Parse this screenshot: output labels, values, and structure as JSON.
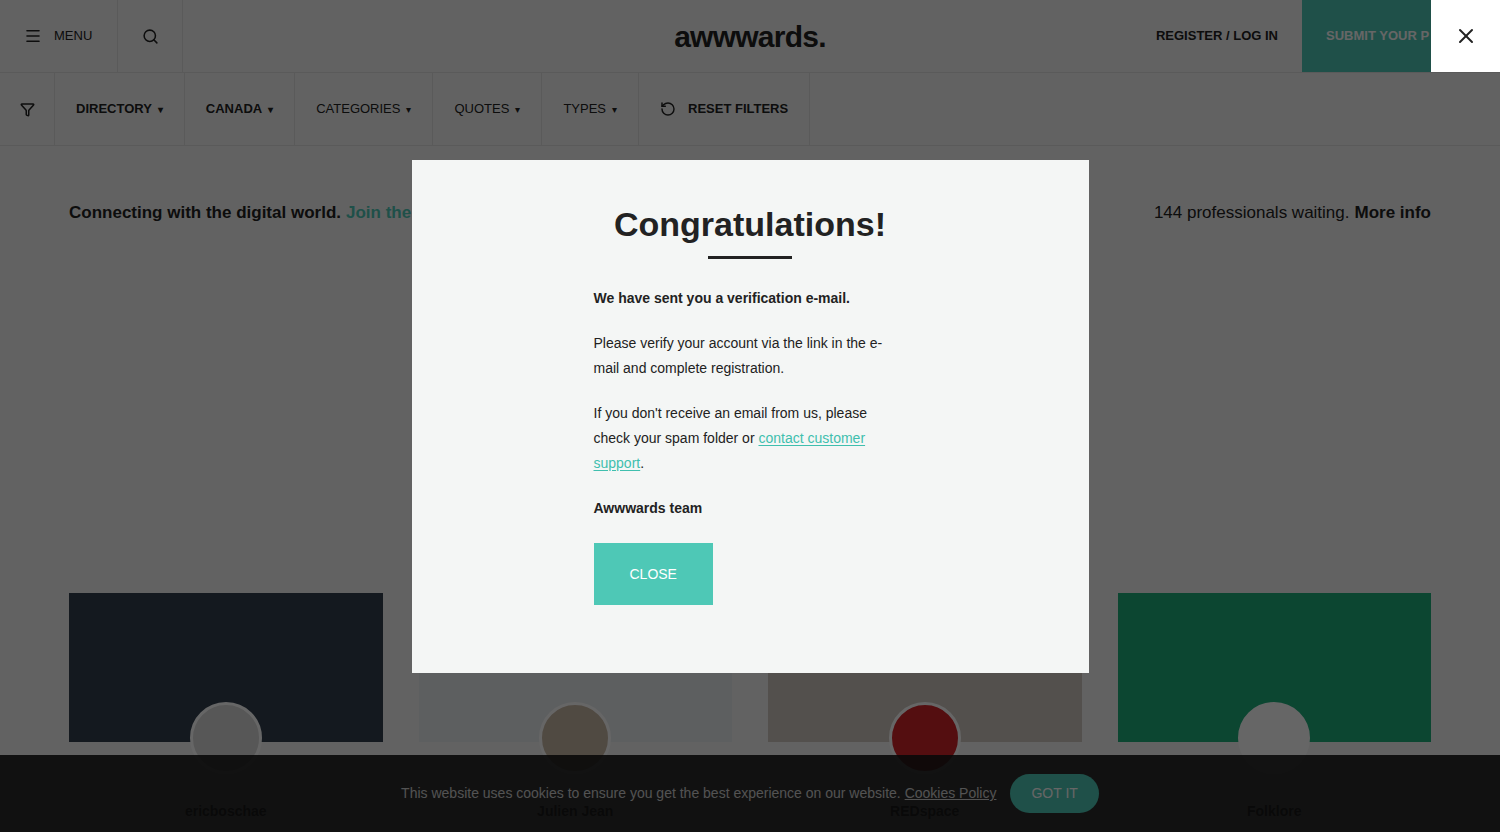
{
  "header": {
    "menu_label": "MENU",
    "logo": "awwwards.",
    "register": "REGISTER / LOG IN",
    "submit": "SUBMIT YOUR P"
  },
  "filters": [
    {
      "label": "DIRECTORY",
      "caret": "▾",
      "active": true,
      "kind": "dropdown"
    },
    {
      "label": "CANADA",
      "caret": "▾",
      "active": true,
      "kind": "dropdown"
    },
    {
      "label": "CATEGORIES",
      "caret": "▾",
      "active": false,
      "kind": "dropdown"
    },
    {
      "label": "QUOTES",
      "caret": "▾",
      "active": false,
      "kind": "dropdown"
    },
    {
      "label": "TYPES",
      "caret": "▾",
      "active": false,
      "kind": "dropdown"
    },
    {
      "label": "RESET FILTERS",
      "caret": "",
      "active": true,
      "kind": "reset"
    }
  ],
  "intro": {
    "text": "Connecting with the digital world.",
    "link": "Join the",
    "waiting": "144 professionals waiting.",
    "more": "More info"
  },
  "cards": [
    {
      "name": "ericboschae",
      "color": "#33404f",
      "avatar_color": "#d9d9d9"
    },
    {
      "name": "Julien Jean",
      "color": "#e9edf0",
      "avatar_color": "#c9b8a5"
    },
    {
      "name": "REDspace",
      "color": "#cfc8c0",
      "avatar_color": "#d2232a"
    },
    {
      "name": "Folklore",
      "color": "#1fae7c",
      "avatar_color": "#ffffff"
    }
  ],
  "cookie": {
    "text": "This website uses cookies to ensure you get the best experience on our website.",
    "link": "Cookies Policy",
    "button": "GOT IT"
  },
  "modal": {
    "title": "Congratulations!",
    "lead": "We have sent you a verification e-mail.",
    "paragraph1": "Please verify your account via the link in the e-mail and complete registration.",
    "paragraph2": "If you don't receive an email from us, please check your spam folder or",
    "support_link": "contact customer support",
    "period": ".",
    "signature": "Awwwards team",
    "button": "CLOSE"
  }
}
